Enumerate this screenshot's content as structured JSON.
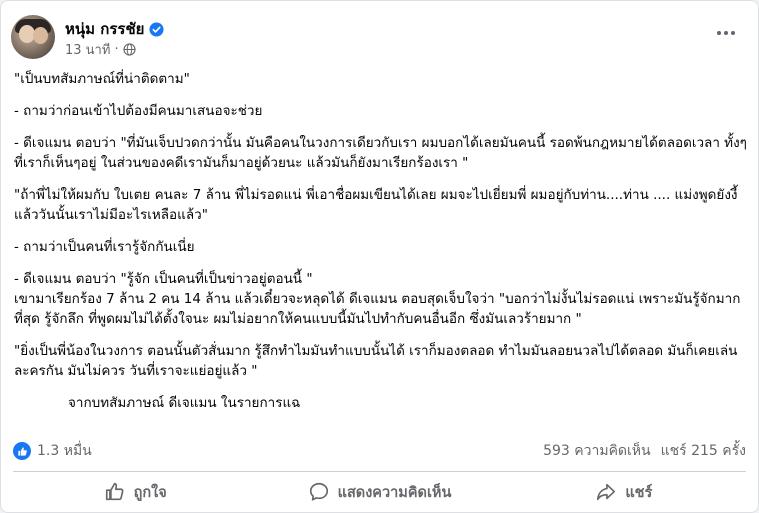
{
  "post": {
    "author": "หนุ่ม กรรชัย",
    "time": "13 นาที",
    "time_separator": "·",
    "paragraphs": [
      "\"เป็นบทสัมภาษณ์ที่น่าติดตาม\"",
      "- ถามว่าก่อนเข้าไปต้องมีคนมาเสนอจะช่วย",
      "- ดีเจแมน ตอบว่า  \"ที่มันเจ็บปวดกว่านั้น มันคือคนในวงการเดียวกับเรา ผมบอกได้เลยมันคนนี้ รอดพ้นกฎหมายได้ตลอดเวลา ทั้งๆที่เราก็เห็นๆอยู่ ในส่วนของคดีเรามันก็มาอยู่ด้วยนะ แล้วมันก็ยังมาเรียกร้องเรา \"",
      "\"ถ้าพี่ไม่ให้ผมกับ ใบเตย คนละ 7 ล้าน พี่ไม่รอดแน่ พี่เอาชื่อผมเขียนได้เลย ผมจะไปเยี่ยมพี่ ผมอยู่กับท่าน....ท่าน .... แม่งพูดยังงี้ แล้ววันนั้นเราไม่มีอะไรเหลือแล้ว\"",
      "- ถามว่าเป็นคนที่เรารู้จักกันเนี่ย",
      "- ดีเจแมน ตอบว่า  \"รู้จัก เป็นคนที่เป็นข่าวอยู่ตอนนี้ \"\nเขามาเรียกร้อง 7 ล้าน 2 คน 14 ล้าน แล้วเดี๋ยวจะหลุดได้ ดีเจแมน ตอบสุดเจ็บใจว่า \"บอกว่าไม่งั้นไม่รอดแน่ เพราะมันรู้จักมากที่สุด รู้จักลึก ที่พูดผมไม่ได้ตั้งใจนะ ผมไม่อยากให้คนแบบนี้มันไปทำกับคนอื่นอีก ซึ่งมันเลวร้ายมาก \"",
      "\"ยิ่งเป็นพี่น้องในวงการ ตอนนั้นตัวสั่นมาก รู้สึกทำไมมันทำแบบนั้นได้ เราก็มองตลอด ทำไมมันลอยนวลไปได้ตลอด มันก็เคยเล่นละครกัน มันไม่ควร วันที่เราจะแย่อยู่แล้ว \""
    ],
    "credit": "จากบทสัมภาษณ์ ดีเจแมน ในรายการแฉ"
  },
  "stats": {
    "reactions": "1.3 หมื่น",
    "comments": "593 ความคิดเห็น",
    "shares": "แชร์ 215 ครั้ง"
  },
  "actions": {
    "like": "ถูกใจ",
    "comment": "แสดงความคิดเห็น",
    "share": "แชร์"
  },
  "icons": {
    "verified": "verified-badge-icon",
    "globe": "globe-icon",
    "more": "more-options-icon",
    "like_reaction": "like-reaction-icon",
    "like": "thumbs-up-icon",
    "comment": "comment-bubble-icon",
    "share": "share-arrow-icon"
  },
  "colors": {
    "accent": "#1877f2",
    "secondary_text": "#65676b",
    "primary_text": "#050505"
  }
}
